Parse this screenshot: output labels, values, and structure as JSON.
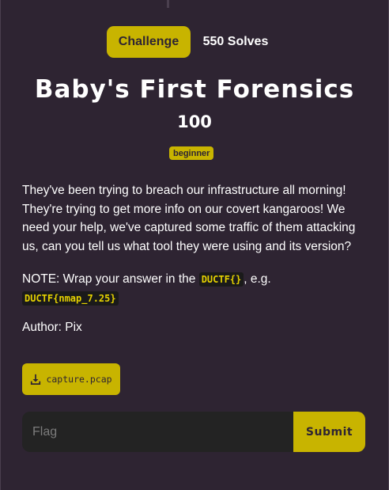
{
  "tabs": {
    "challenge_label": "Challenge",
    "solves_label": "550 Solves"
  },
  "challenge": {
    "title": "Baby's First Forensics",
    "points": "100",
    "tag": "beginner",
    "description": "They've been trying to breach our infrastructure all morning! They're trying to get more info on our covert kangaroos! We need your help, we've captured some traffic of them attacking us, can you tell us what tool they were using and its version?",
    "note_prefix": "NOTE: Wrap your answer in the ",
    "note_code_1": "DUCTF{}",
    "note_middle": ", e.g.",
    "note_code_2": "DUCTF{nmap_7.25}",
    "author": "Author: Pix"
  },
  "file": {
    "name": "capture.pcap",
    "icon": "download-icon"
  },
  "flag_form": {
    "placeholder": "Flag",
    "value": "",
    "submit_label": "Submit"
  },
  "colors": {
    "background": "#2e2432",
    "accent": "#c8b400",
    "input_bg": "#232323",
    "code_text": "#e6d200"
  }
}
